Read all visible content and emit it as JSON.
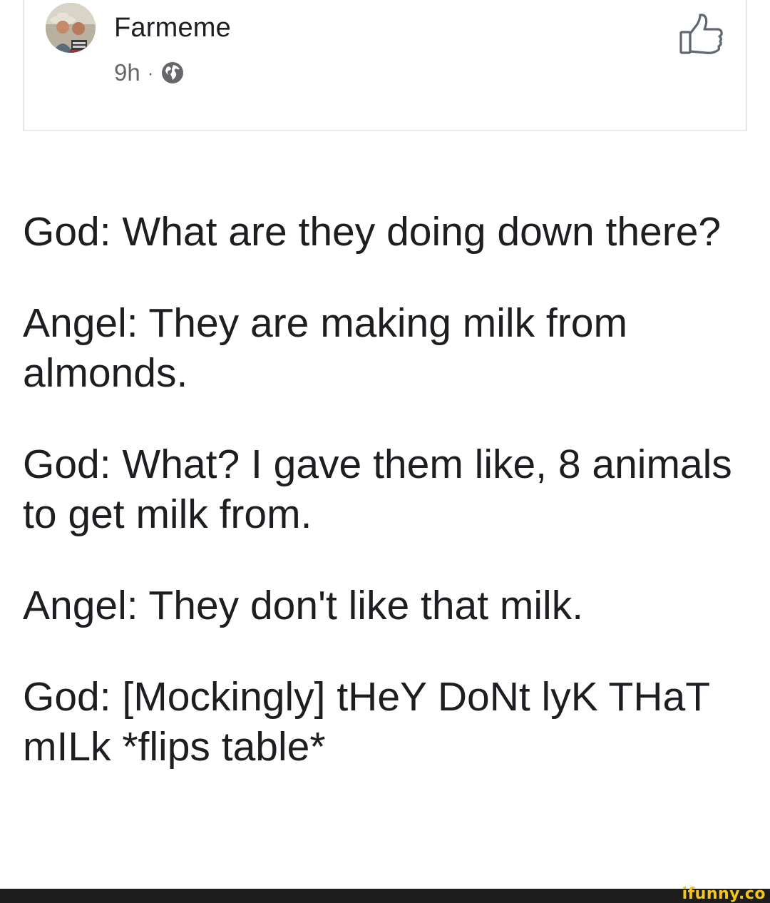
{
  "post": {
    "author": "Farmeme",
    "timestamp": "9h",
    "separator": "·",
    "visibility_icon": "globe-icon",
    "like_icon": "thumbs-up-outline-icon",
    "paragraphs": [
      "God: What are they doing down there?",
      "Angel: They are making milk from almonds.",
      "God: What? I gave them like, 8 animals to get milk from.",
      "Angel: They don't like that milk.",
      "God: [Mockingly] tHeY DoNt lyK THaT mILk *flips table*"
    ]
  },
  "watermark": {
    "text": "ifunny.co"
  },
  "colors": {
    "text": "#1c1e21",
    "meta": "#65676b",
    "watermark": "#f5c518",
    "bottom_bar": "#1d1d1d"
  }
}
